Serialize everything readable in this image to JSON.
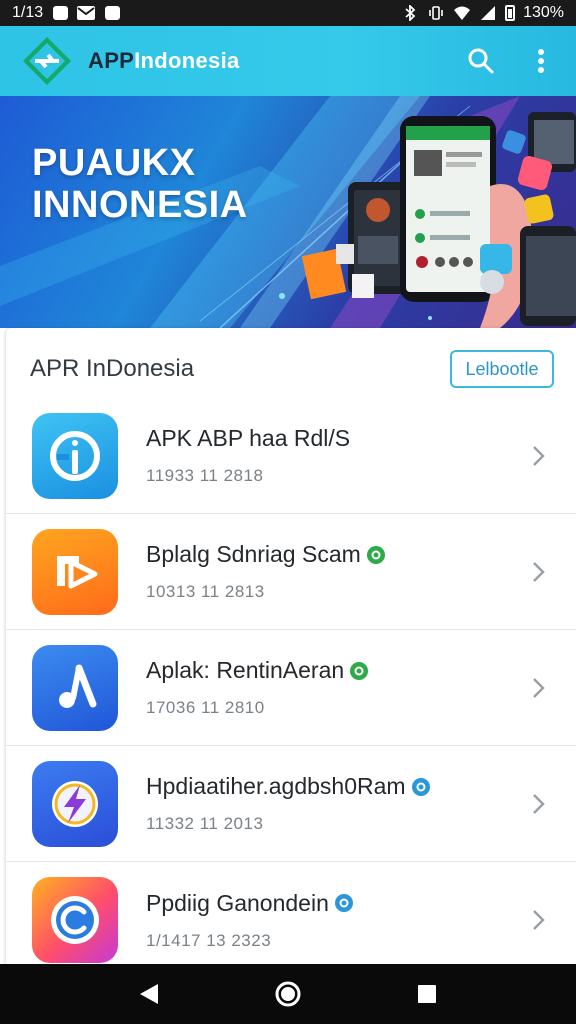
{
  "status_bar": {
    "time": "1/13",
    "battery": "130%"
  },
  "app_bar": {
    "title_dark": "APP",
    "title_light": "Indonesia",
    "search_icon": "search-icon",
    "menu_icon": "more-vert-icon"
  },
  "banner": {
    "line1": "PUAUKX",
    "line2": "INNONESIA"
  },
  "section": {
    "title": "APR InDonesia",
    "button_label": "Lelbootle"
  },
  "apps": [
    {
      "name": "APK ABP haa Rdl/S",
      "meta": "11933 11 2818",
      "icon": "info-g-icon",
      "verified": false
    },
    {
      "name": "Bplalg Sdnriag Scam",
      "meta": "10313 11 2813",
      "icon": "play-arrow-icon",
      "verified": true,
      "badge_color": "#2eaa4a"
    },
    {
      "name": "Aplak: RentinAeran",
      "meta": "17036 11 2810",
      "icon": "music-note-icon",
      "verified": true,
      "badge_color": "#2eaa4a"
    },
    {
      "name": "Hpdiaatiher.agdbsh0Ram",
      "meta": "11332 11 2013",
      "icon": "lightning-icon",
      "verified": true,
      "badge_color": "#2a97d8"
    },
    {
      "name": "Ppdiig Ganondein",
      "meta": "1/1417 13 2323",
      "icon": "c-ring-icon",
      "verified": true,
      "badge_color": "#2a97d8"
    }
  ],
  "colors": {
    "app_bar": "#2ec4e6",
    "accent": "#3bb8e0",
    "text_primary": "#25292d",
    "text_secondary": "#7a8288"
  }
}
